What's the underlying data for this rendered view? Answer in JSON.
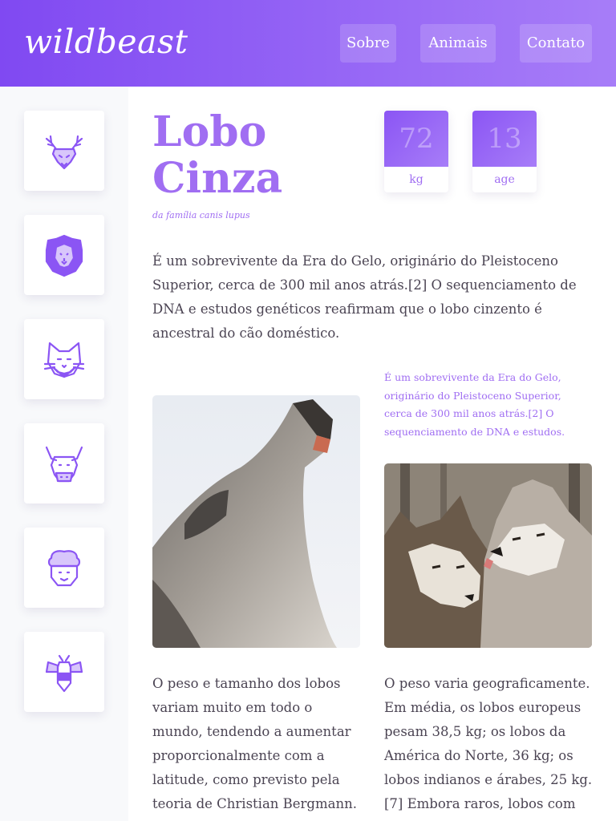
{
  "header": {
    "logo": "wildbeast",
    "nav": [
      {
        "label": "Sobre"
      },
      {
        "label": "Animais"
      },
      {
        "label": "Contato"
      }
    ]
  },
  "sidebar": {
    "icons": [
      "deer-icon",
      "lion-icon",
      "cat-icon",
      "bull-icon",
      "sheep-icon",
      "bee-icon"
    ]
  },
  "animal": {
    "name_line1": "Lobo",
    "name_line2": "Cinza",
    "subtitle": "da família canis lupus",
    "stats": [
      {
        "value": "72",
        "unit": "kg"
      },
      {
        "value": "13",
        "unit": "age"
      }
    ],
    "intro": "É um sobrevivente da Era do Gelo, originário do Pleistoceno Superior, cerca de 300 mil anos atrás.[2] O sequenciamento de DNA e estudos genéticos reafirmam que o lobo cinzento é ancestral do cão doméstico.",
    "aside_note": "É um sobrevivente da Era do Gelo, originário do Pleistoceno Superior, cerca de 300 mil anos atrás.[2] O sequenciamento de DNA e estudos.",
    "col_left": "O peso e tamanho dos lobos variam muito em todo o mundo, tendendo a aumentar proporcionalmente com a latitude, como previsto pela teoria de Christian Bergmann.",
    "col_right": "O peso varia geograficamente. Em média, os lobos europeus pesam 38,5 kg; os lobos da América do Norte, 36 kg; os lobos indianos e árabes, 25 kg.[7] Embora raros, lobos com"
  },
  "colors": {
    "accent": "#a06ef2",
    "header_start": "#8049f2",
    "header_end": "#a77df8",
    "sidebar_bg": "#f8f9fb"
  }
}
